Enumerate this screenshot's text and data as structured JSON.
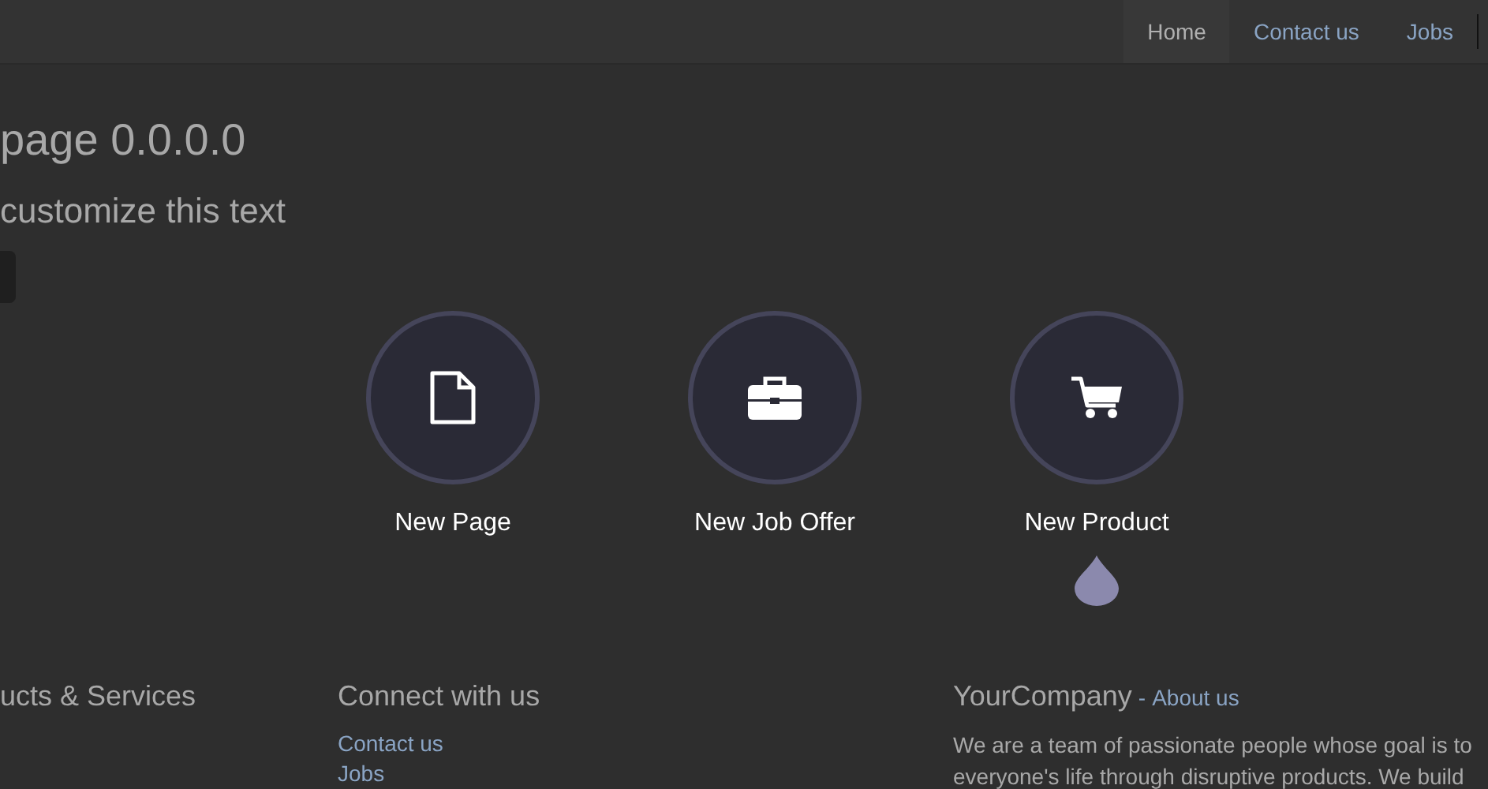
{
  "nav": {
    "items": [
      {
        "label": "Home",
        "selected": true
      },
      {
        "label": "Contact us",
        "selected": false
      },
      {
        "label": "Jobs",
        "selected": false
      }
    ]
  },
  "hero": {
    "title": "page 0.0.0.0",
    "subtitle": "customize this text"
  },
  "dialog": {
    "options": [
      {
        "label": "New Page",
        "kind": "page",
        "selected": false
      },
      {
        "label": "New Job Offer",
        "kind": "job",
        "selected": false
      },
      {
        "label": "New Product",
        "kind": "product",
        "selected": true
      }
    ]
  },
  "footer": {
    "products_heading": "ucts & Services",
    "connect_heading": "Connect with us",
    "connect_links": [
      "Contact us",
      "Jobs"
    ],
    "company_name": "YourCompany",
    "company_separator": "-",
    "about_link": "About us",
    "about_lines": [
      "We are a team of passionate people whose goal is to",
      "everyone's life through disruptive products. We build"
    ]
  }
}
